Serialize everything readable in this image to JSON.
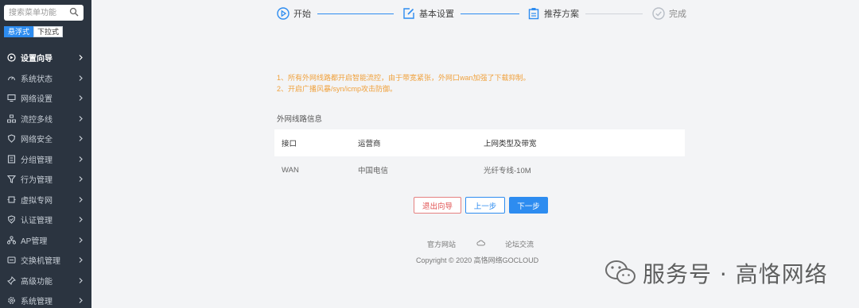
{
  "sidebar": {
    "search_placeholder": "搜索菜单功能",
    "modes": [
      "悬浮式",
      "下拉式"
    ],
    "items": [
      {
        "label": "设置向导",
        "icon": "wizard-icon"
      },
      {
        "label": "系统状态",
        "icon": "gauge-icon"
      },
      {
        "label": "网络设置",
        "icon": "monitor-icon"
      },
      {
        "label": "流控多线",
        "icon": "flow-icon"
      },
      {
        "label": "网络安全",
        "icon": "shield-icon"
      },
      {
        "label": "分组管理",
        "icon": "group-icon"
      },
      {
        "label": "行为管理",
        "icon": "filter-icon"
      },
      {
        "label": "虚拟专网",
        "icon": "vpn-icon"
      },
      {
        "label": "认证管理",
        "icon": "auth-shield-icon"
      },
      {
        "label": "AP管理",
        "icon": "ap-icon"
      },
      {
        "label": "交换机管理",
        "icon": "switch-icon"
      },
      {
        "label": "高级功能",
        "icon": "pin-icon"
      },
      {
        "label": "系统管理",
        "icon": "gear-icon"
      }
    ]
  },
  "steps": [
    {
      "label": "开始",
      "icon": "play-icon"
    },
    {
      "label": "基本设置",
      "icon": "edit-icon"
    },
    {
      "label": "推荐方案",
      "icon": "clipboard-icon"
    },
    {
      "label": "完成",
      "icon": "check-circle-icon"
    }
  ],
  "notice": [
    "1、所有外网线路都开启智能流控，由于带宽紧张，外网口wan加强了下载抑制。",
    "2、开启广播风暴/syn/icmp攻击防御。"
  ],
  "table": {
    "title": "外网线路信息",
    "headers": [
      "接口",
      "运营商",
      "上网类型及带宽"
    ],
    "rows": [
      [
        "WAN",
        "中国电信",
        "光纤专线-10M"
      ]
    ]
  },
  "buttons": {
    "exit": "退出向导",
    "prev": "上一步",
    "next": "下一步"
  },
  "footer": {
    "official_site": "官方网站",
    "forum": "论坛交流",
    "copyright": "Copyright © 2020 高恪网络GOCLOUD"
  },
  "watermark": "服务号 · 高恪网络",
  "colors": {
    "accent": "#2d8cf0",
    "sidebar_bg": "#2b3440",
    "warning": "#f0a13c",
    "danger": "#e05050"
  }
}
